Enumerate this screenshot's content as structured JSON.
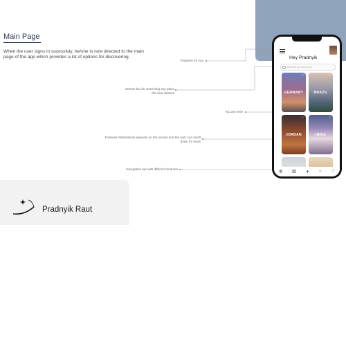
{
  "title": "Main Page",
  "description": "When the user signs in sucessfuly, he/she is now directed to the main page of the app which provides a lot of options for discovering.",
  "annotations": {
    "features": "Features for you",
    "search": "Search bar for searching any place the user desires",
    "you_are_here": "You are here",
    "destinations": "Features destinations appears on the screen and the user can scroll down for more",
    "navigation": "Navigation bar with different features"
  },
  "author": "Pradnyik Raut",
  "phone": {
    "greeting": "Hey Pradnyik",
    "search_placeholder": "Where do you want to go?",
    "cards": [
      {
        "label": "GERMANY"
      },
      {
        "label": "BRAZIL"
      },
      {
        "label": "JORDAN"
      },
      {
        "label": "INDIA"
      }
    ],
    "nav_icons": [
      "globe-icon",
      "buildings-icon",
      "add-icon",
      "chat-icon",
      "heart-icon"
    ]
  },
  "colors": {
    "panel": "#8fa3bb",
    "title": "#2a3850",
    "card_background": "#f2f2f2"
  }
}
